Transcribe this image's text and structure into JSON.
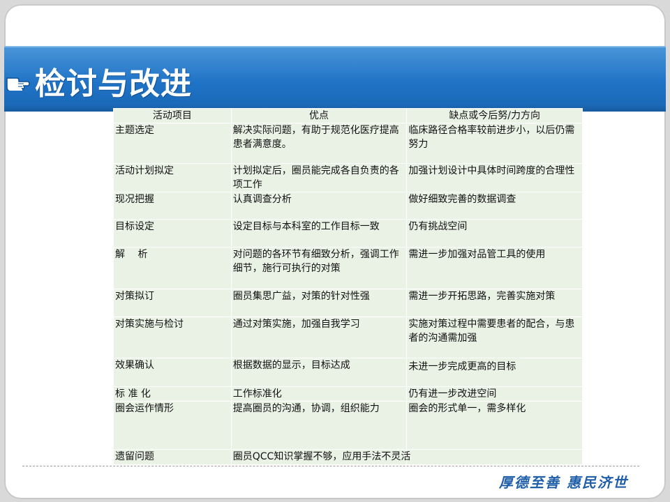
{
  "page": {
    "title": "检讨与改进",
    "footer_slogan": "厚德至善 惠民济世"
  },
  "icons": {
    "title_bullet": "pointing-hand-icon"
  },
  "colors": {
    "title_band": "#1f73c6",
    "table_cell": "#eaf2e5",
    "slogan": "#1f5ea8"
  },
  "table": {
    "headers": [
      "活动项目",
      "优点",
      "缺点或今后努/力方向"
    ],
    "rows": [
      {
        "item": "主题选定",
        "pros": "解决实际问题，有助于规范化医疗提高患者满意度。",
        "cons": "临床路径合格率较前进步小，以后仍需努力"
      },
      {
        "item": "活动计划拟定",
        "pros": "计划拟定后，圈员能完成各自负责的各项工作",
        "cons": "加强计划设计中具体时间跨度的合理性"
      },
      {
        "item": "现况把握",
        "pros": "认真调查分析",
        "cons": "做好细致完善的数据调查"
      },
      {
        "item": "目标设定",
        "pros": "设定目标与本科室的工作目标一致",
        "cons": "仍有挑战空间"
      },
      {
        "item": "解　 析",
        "pros": "对问题的各环节有细致分析，强调工作细节，施行可执行的对策",
        "cons": "需进一步加强对品管工具的使用"
      },
      {
        "item": "对策拟订",
        "pros": "圈员集思广益，对策的针对性强",
        "cons": "需进一步开拓思路，完善实施对策"
      },
      {
        "item": "对策实施与检讨",
        "pros": "通过对策实施，加强自我学习",
        "cons": "实施对策过程中需要患者的配合，与患者的沟通需加强"
      },
      {
        "item": "效果确认",
        "pros": "根据数据的显示，目标达成",
        "cons": "未进一步完成更高的目标"
      },
      {
        "item": "标 准 化",
        "pros": "工作标准化",
        "cons": "仍有进一步改进空间"
      },
      {
        "item": "圈会运作情形",
        "pros": "提高圈员的沟通，协调，组织能力",
        "cons": "圈会的形式单一，需多样化"
      },
      {
        "item": "遗留问题",
        "pros": "圈员QCC知识掌握不够，应用手法不灵活",
        "cons": ""
      }
    ]
  }
}
